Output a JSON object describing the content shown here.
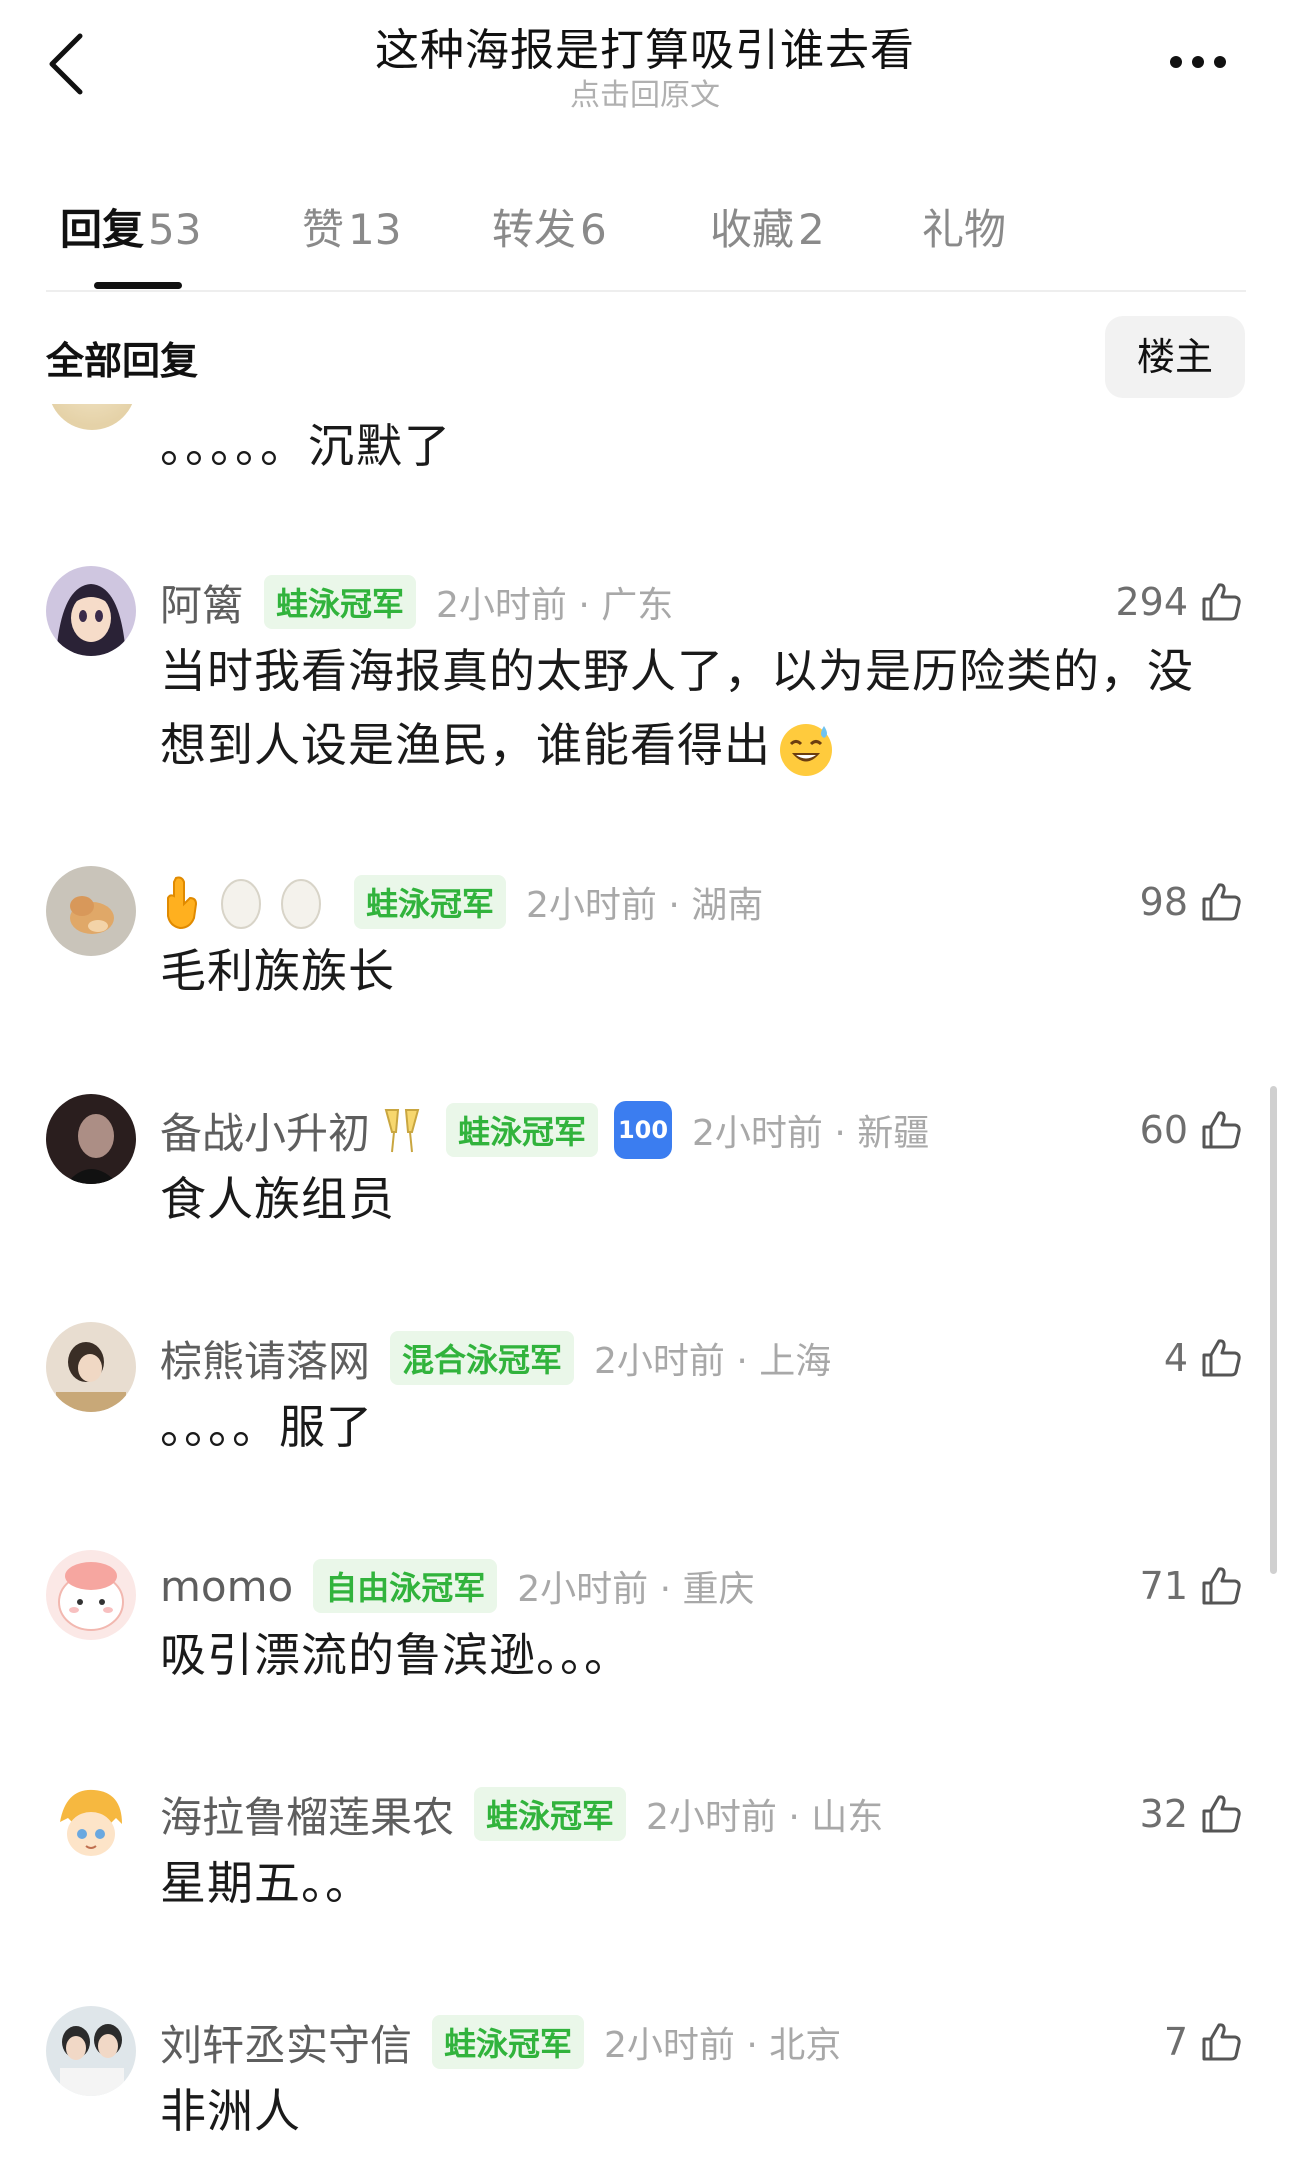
{
  "header": {
    "title": "这种海报是打算吸引谁去看",
    "subtitle": "点击回原文"
  },
  "tabs": [
    {
      "label": "回复",
      "count": "53",
      "active": true
    },
    {
      "label": "赞",
      "count": "13"
    },
    {
      "label": "转发",
      "count": "6"
    },
    {
      "label": "收藏",
      "count": "2"
    },
    {
      "label": "礼物",
      "count": ""
    }
  ],
  "section": {
    "title": "全部回复",
    "op_button": "楼主"
  },
  "partial_comment": {
    "text": "。。。。。沉默了"
  },
  "comments": [
    {
      "username": "阿篱",
      "badge": "蛙泳冠军",
      "time": "2小时前 · 广东",
      "likes": "294",
      "text": "当时我看海报真的太野人了，以为是历险类的，没想到人设是渔民，谁能看得出",
      "emoji": "sweat-smile-emoji"
    },
    {
      "username": "",
      "name_icons": [
        "point-down-emoji",
        "egg-emoji",
        "egg-emoji"
      ],
      "badge": "蛙泳冠军",
      "time": "2小时前 · 湖南",
      "likes": "98",
      "text": "毛利族族长"
    },
    {
      "username": "备战小升初",
      "name_icon": "clinking-glasses-emoji",
      "badge": "蛙泳冠军",
      "extra_badge": "100",
      "time": "2小时前 · 新疆",
      "likes": "60",
      "text": "食人族组员"
    },
    {
      "username": "棕熊请落网",
      "badge": "混合泳冠军",
      "time": "2小时前 · 上海",
      "likes": "4",
      "text": "。。。。服了"
    },
    {
      "username": "momo",
      "badge": "自由泳冠军",
      "time": "2小时前 · 重庆",
      "likes": "71",
      "text": "吸引漂流的鲁滨逊。。。"
    },
    {
      "username": "海拉鲁榴莲果农",
      "badge": "蛙泳冠军",
      "time": "2小时前 · 山东",
      "likes": "32",
      "text": "星期五。。"
    },
    {
      "username": "刘轩丞实守信",
      "badge": "蛙泳冠军",
      "time": "2小时前 · 北京",
      "likes": "7",
      "text": "非洲人"
    }
  ],
  "colors": {
    "badge_bg": "#eaf7e9",
    "badge_text": "#31b33c",
    "meta_text": "#a8a8a8"
  }
}
